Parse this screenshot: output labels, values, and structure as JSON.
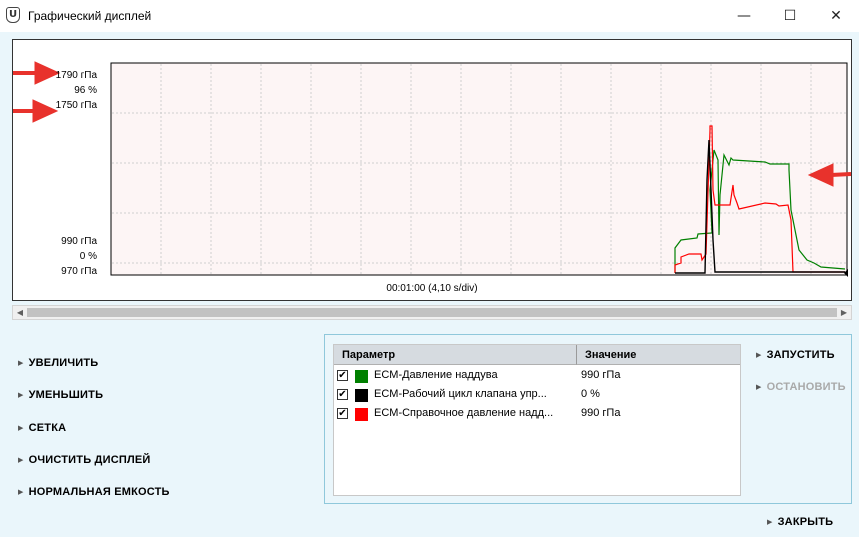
{
  "window": {
    "title": "Графический дисплей",
    "icon": "shield-app-icon",
    "controls": {
      "minimize": "—",
      "maximize": "☐",
      "close": "✕"
    }
  },
  "graph": {
    "scale_labels": {
      "top_green": "1790 гПа",
      "top_black": "96 %",
      "top_red": "1750 гПа",
      "bottom_red": "990 гПа",
      "bottom_black": "0 %",
      "bottom_green": "970 гПа"
    },
    "time_label": "00:01:00 (4,10 s/div)",
    "colors": {
      "green": "#008000",
      "black": "#000000",
      "red": "#ff0000",
      "annotation": "#e8322c",
      "plot_bg": "#fdf5f5",
      "grid": "#cfcfcf"
    },
    "grid_on": true
  },
  "actions": {
    "zoom_in": "УВЕЛИЧИТЬ",
    "zoom_out": "УМЕНЬШИТЬ",
    "grid": "СЕТКА",
    "clear": "ОЧИСТИТЬ ДИСПЛЕЙ",
    "normal_capacity": "НОРМАЛЬНАЯ ЕМКОСТЬ"
  },
  "params_table": {
    "headers": {
      "param": "Параметр",
      "value": "Значение"
    },
    "rows": [
      {
        "checked": "✔",
        "color": "#008000",
        "name": "ECM-Давление наддува",
        "value": "990 гПа"
      },
      {
        "checked": "✔",
        "color": "#000000",
        "name": "ECM-Рабочий цикл клапана упр...",
        "value": "0 %"
      },
      {
        "checked": "✔",
        "color": "#ff0000",
        "name": "ECM-Справочное давление надд...",
        "value": "990 гПа"
      }
    ]
  },
  "buttons": {
    "start": "ЗАПУСТИТЬ",
    "stop": "ОСТАНОВИТЬ",
    "close": "ЗАКРЫТЬ"
  }
}
